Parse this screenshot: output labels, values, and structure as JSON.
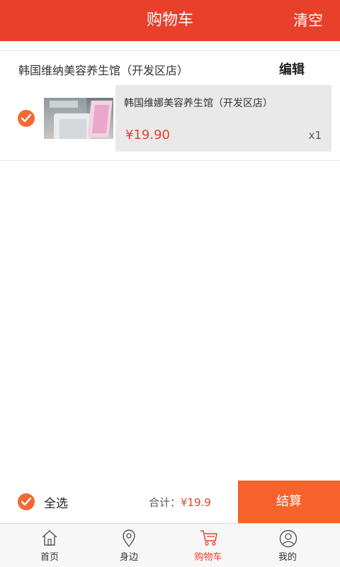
{
  "header": {
    "title": "购物车",
    "clear_label": "清空"
  },
  "store": {
    "name": "韩国维纳美容养生馆（开发区店）",
    "edit_label": "编辑"
  },
  "items": [
    {
      "name": "韩国维娜美容养生馆（开发区店）",
      "price": "¥19.90",
      "quantity": "x1",
      "checked": true
    }
  ],
  "checkout": {
    "select_all_label": "全选",
    "total_label": "合计：",
    "total_value": "¥19.9",
    "button_label": "结算"
  },
  "tabs": [
    {
      "label": "首页",
      "icon": "home-icon"
    },
    {
      "label": "身边",
      "icon": "location-pin-icon"
    },
    {
      "label": "购物车",
      "icon": "cart-icon",
      "active": true
    },
    {
      "label": "我的",
      "icon": "user-icon"
    }
  ],
  "colors": {
    "accent": "#e8402a",
    "checkout_button": "#f5632a",
    "check": "#f06a35"
  }
}
